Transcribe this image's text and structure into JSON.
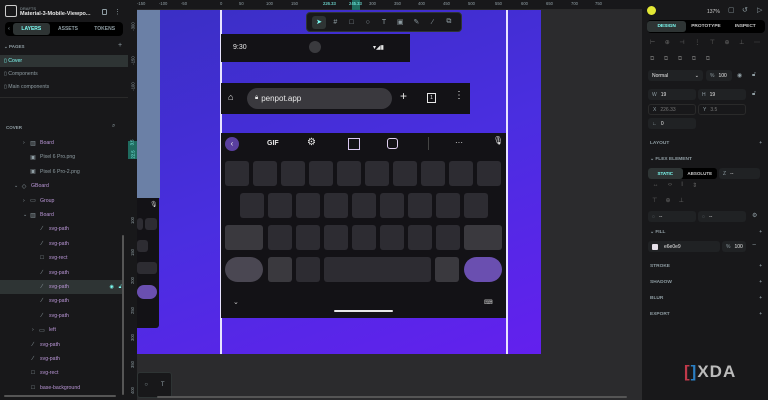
{
  "header": {
    "project": "DRAFTS",
    "file_name": "Material-3-Mobile-Viewpo..."
  },
  "left_tabs": [
    "LAYERS",
    "ASSETS",
    "TOKENS"
  ],
  "pages": {
    "title": "PAGES",
    "items": [
      "Cover",
      "Components",
      "Main components"
    ]
  },
  "layers": {
    "title": "COVER",
    "items": [
      {
        "name": "Board",
        "type": "board",
        "indent": 2,
        "chev": "›"
      },
      {
        "name": "Pixel 6 Pro.png",
        "type": "image",
        "indent": 2,
        "chev": ""
      },
      {
        "name": "Pixel 6 Pro-2.png",
        "type": "image",
        "indent": 2,
        "chev": ""
      },
      {
        "name": "GBoard",
        "type": "component",
        "indent": 1,
        "chev": "⌄"
      },
      {
        "name": "Group",
        "type": "group",
        "indent": 2,
        "chev": "›"
      },
      {
        "name": "Board",
        "type": "board",
        "indent": 2,
        "chev": "⌄"
      },
      {
        "name": "svg-path",
        "type": "path",
        "indent": 3,
        "chev": ""
      },
      {
        "name": "svg-path",
        "type": "path",
        "indent": 3,
        "chev": ""
      },
      {
        "name": "svg-rect",
        "type": "rect",
        "indent": 3,
        "chev": ""
      },
      {
        "name": "svg-path",
        "type": "path",
        "indent": 3,
        "chev": ""
      },
      {
        "name": "svg-path",
        "type": "path",
        "indent": 3,
        "chev": "",
        "selected": true
      },
      {
        "name": "svg-path",
        "type": "path",
        "indent": 3,
        "chev": ""
      },
      {
        "name": "svg-path",
        "type": "path",
        "indent": 3,
        "chev": ""
      },
      {
        "name": "left",
        "type": "group",
        "indent": 3,
        "chev": "›"
      },
      {
        "name": "svg-path",
        "type": "path",
        "indent": 2,
        "chev": ""
      },
      {
        "name": "svg-path",
        "type": "path",
        "indent": 2,
        "chev": ""
      },
      {
        "name": "svg-rect",
        "type": "rect",
        "indent": 2,
        "chev": ""
      },
      {
        "name": "base-background",
        "type": "rect",
        "indent": 2,
        "chev": ""
      }
    ]
  },
  "ruler_top": [
    "-150",
    "-100",
    "-50",
    "0",
    "50",
    "100",
    "150",
    "226.33",
    "245.33",
    "300",
    "350",
    "400",
    "450",
    "500",
    "550",
    "600",
    "650",
    "700",
    "750"
  ],
  "ruler_left": [
    "-300",
    "-150",
    "-100",
    "3.5",
    "22.5",
    "100",
    "150",
    "200",
    "250",
    "300",
    "350",
    "400",
    "450"
  ],
  "phone": {
    "time": "9:30",
    "url": "penpot.app",
    "tab_count": "1",
    "gif": "GIF"
  },
  "right": {
    "zoom": "137%",
    "tabs": [
      "DESIGN",
      "PROTOTYPE",
      "INSPECT"
    ],
    "blend": "Normal",
    "opacity": "100",
    "w": "19",
    "h": "19",
    "x": "226.33",
    "y": "3.5",
    "radius": "0",
    "w_label": "W",
    "h_label": "H",
    "x_label": "X",
    "y_label": "Y",
    "layout": "LAYOUT",
    "flex_element": "FLEX ELEMENT",
    "static": "STATIC",
    "absolute": "ABSOLUTE",
    "z": "--",
    "min": "--",
    "max": "--",
    "fill": "FILL",
    "fill_hex": "e6e0e9",
    "fill_opacity": "100",
    "stroke": "STROKE",
    "shadow": "SHADOW",
    "blur": "BLUR",
    "export": "EXPORT",
    "pct": "%"
  },
  "watermark": "XDA",
  "colors": {
    "accent": "#7efff5",
    "board": "#4a2ee0",
    "fill": "#e6e0e9"
  }
}
